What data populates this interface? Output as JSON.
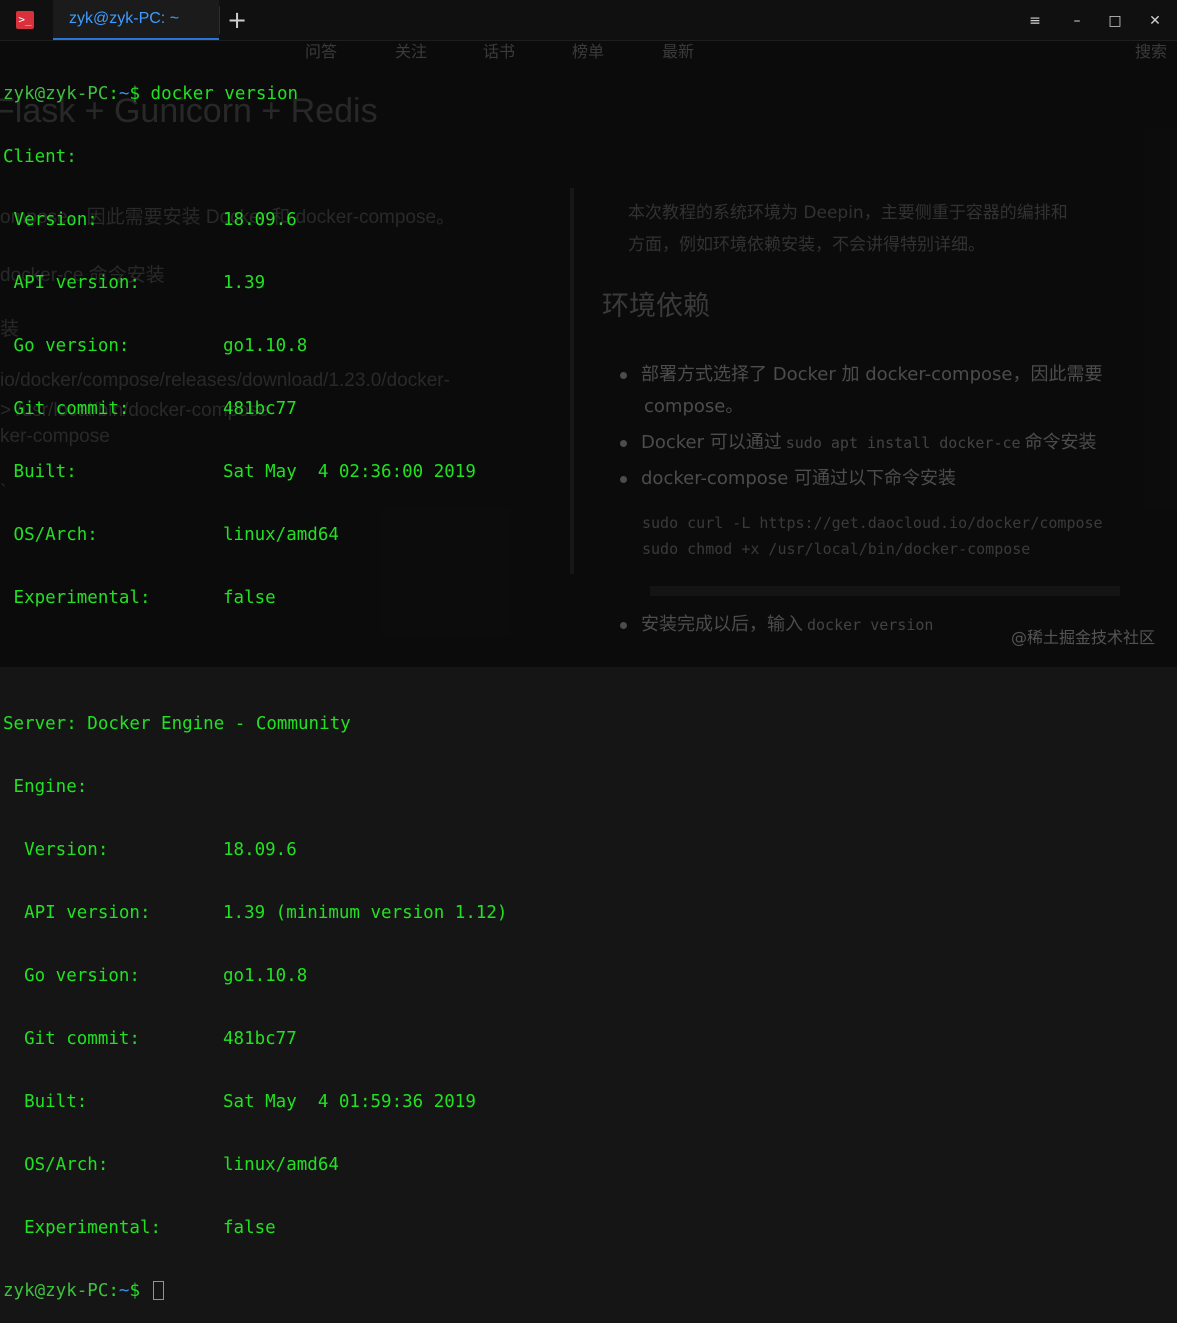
{
  "window": {
    "tab_title": "zyk@zyk-PC: ~",
    "new_tab_label": "+",
    "controls": {
      "menu": "≡",
      "minimize": "–",
      "maximize": "□",
      "close": "✕"
    }
  },
  "terminal": {
    "prompt_user": "zyk@zyk-PC",
    "prompt_sep": ":",
    "prompt_path": "~",
    "prompt_symbol": "$",
    "command": "docker version",
    "client_header": "Client:",
    "client": [
      {
        "key": " Version:",
        "value": "18.09.6"
      },
      {
        "key": " API version:",
        "value": "1.39"
      },
      {
        "key": " Go version:",
        "value": "go1.10.8"
      },
      {
        "key": " Git commit:",
        "value": "481bc77"
      },
      {
        "key": " Built:",
        "value": "Sat May  4 02:36:00 2019"
      },
      {
        "key": " OS/Arch:",
        "value": "linux/amd64"
      },
      {
        "key": " Experimental:",
        "value": "false"
      }
    ],
    "server_header": "Server: Docker Engine - Community",
    "engine_header": " Engine:",
    "engine": [
      {
        "key": "  Version:",
        "value": "18.09.6"
      },
      {
        "key": "  API version:",
        "value": "1.39 (minimum version 1.12)"
      },
      {
        "key": "  Go version:",
        "value": "go1.10.8"
      },
      {
        "key": "  Git commit:",
        "value": "481bc77"
      },
      {
        "key": "  Built:",
        "value": "Sat May  4 01:59:36 2019"
      },
      {
        "key": "  OS/Arch:",
        "value": "linux/amd64"
      },
      {
        "key": "  Experimental:",
        "value": "false"
      }
    ]
  },
  "background": {
    "nav": [
      "问答",
      "关注",
      "话书",
      "榜单",
      "最新",
      "搜索"
    ],
    "left_title": "Flask + Gunicorn + Redis",
    "left_lines": [
      "ompose，因此需要安装 Docker 和 docker-compose。",
      "docker-ce 命令安装",
      "装",
      "io/docker/compose/releases/download/1.23.0/docker-",
      "> /usr/local/bin/docker-compose",
      "ker-compose",
      "`"
    ],
    "intro_1": "本次教程的系统环境为 Deepin，主要侧重于容器的编排和",
    "intro_2": "方面，例如环境依赖安装，不会讲得特别详细。",
    "heading": "环境依赖",
    "item_1a": "部署方式选择了 Docker 加 docker-compose，因此需要",
    "item_1b": "compose。",
    "item_2_pre": "Docker 可以通过",
    "item_2_code": "sudo apt install docker-ce",
    "item_2_post": "命令安装",
    "item_3": "docker-compose 可通过以下命令安装",
    "code_1": "sudo curl -L https://get.daocloud.io/docker/compose",
    "code_2": "sudo chmod +x /usr/local/bin/docker-compose",
    "item_4_pre": "安装完成以后，输入",
    "item_4_code": "docker version",
    "watermark": "@稀土掘金技术社区"
  }
}
